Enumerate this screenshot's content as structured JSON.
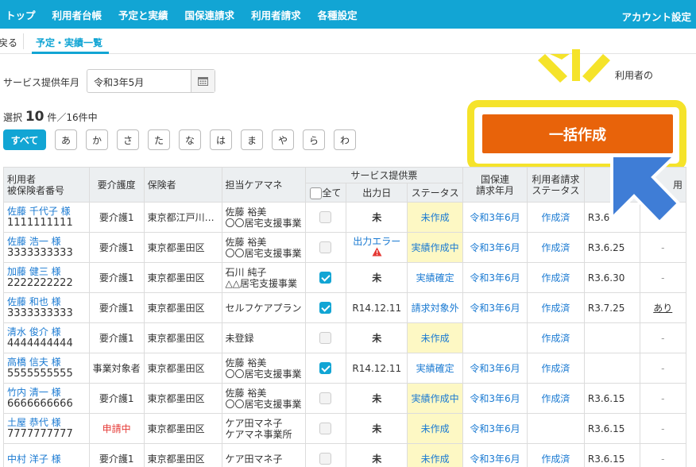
{
  "nav": {
    "items": [
      "トップ",
      "利用者台帳",
      "予定と実績",
      "国保連請求",
      "利用者請求",
      "各種設定"
    ],
    "account": "アカウント設定"
  },
  "sub": {
    "back": "戻る",
    "tab": "予定・実績一覧"
  },
  "month": {
    "label": "サービス提供年月",
    "value": "令和3年5月"
  },
  "notice": "利用者の",
  "selection": {
    "prefix": "選択",
    "count": "10",
    "suffix": "件／16件中"
  },
  "kana": [
    "すべて",
    "あ",
    "か",
    "さ",
    "た",
    "な",
    "は",
    "ま",
    "や",
    "ら",
    "わ"
  ],
  "bulk_button": "一括作成",
  "headers": {
    "user": "利用者",
    "insured_no": "被保険者番号",
    "care": "要介護度",
    "insurer": "保険者",
    "manager": "担当ケアマネ",
    "service": "サービス提供票",
    "all": "全て",
    "out_date": "出力日",
    "status": "ステータス",
    "kokuho1": "国保連",
    "kokuho2": "請求年月",
    "ureq1": "利用者請求",
    "ureq2": "ステータス",
    "c9": "",
    "c10": "",
    "c11": "用"
  },
  "rows": [
    {
      "name": "佐藤 千代子 様",
      "no": "1111111111",
      "care": "要介護1",
      "insurer": "東京都江戸川…",
      "mgr1": "佐藤 裕美",
      "mgr2": "〇〇居宅支援事業",
      "checked": false,
      "out": "未",
      "status": "未作成",
      "status_bg": true,
      "kokuho": "令和3年6月",
      "ureq": "作成済",
      "date": "R3.6",
      "extra": ""
    },
    {
      "name": "佐藤 浩一 様",
      "no": "3333333333",
      "care": "要介護1",
      "insurer": "東京都墨田区",
      "mgr1": "佐藤 裕美",
      "mgr2": "〇〇居宅支援事業",
      "checked": false,
      "out": "出力エラー",
      "status": "実績作成中",
      "status_bg": true,
      "kokuho": "令和3年6月",
      "ureq": "作成済",
      "date": "R3.6.25",
      "extra": "-"
    },
    {
      "name": "加藤 健三 様",
      "no": "2222222222",
      "care": "要介護1",
      "insurer": "東京都墨田区",
      "mgr1": "石川 純子",
      "mgr2": "△△居宅支援事業",
      "checked": true,
      "out": "未",
      "status": "実績確定",
      "status_bg": false,
      "kokuho": "令和3年6月",
      "ureq": "作成済",
      "date": "R3.6.30",
      "extra": "-"
    },
    {
      "name": "佐藤 和也 様",
      "no": "3333333333",
      "care": "要介護1",
      "insurer": "東京都墨田区",
      "mgr1": "セルフケアプラン",
      "mgr2": "",
      "checked": true,
      "out": "R14.12.11",
      "status": "請求対象外",
      "status_bg": false,
      "kokuho": "令和3年6月",
      "ureq": "作成済",
      "date": "R3.7.25",
      "extra": "あり"
    },
    {
      "name": "清水 俊介 様",
      "no": "4444444444",
      "care": "要介護1",
      "insurer": "東京都墨田区",
      "mgr1": "未登録",
      "mgr2": "",
      "checked": false,
      "out": "未",
      "status": "未作成",
      "status_bg": true,
      "kokuho": "",
      "ureq": "作成済",
      "date": "",
      "extra": "-"
    },
    {
      "name": "高橋 信夫 様",
      "no": "5555555555",
      "care": "事業対象者",
      "insurer": "東京都墨田区",
      "mgr1": "佐藤 裕美",
      "mgr2": "〇〇居宅支援事業",
      "checked": true,
      "out": "R14.12.11",
      "status": "実績確定",
      "status_bg": false,
      "kokuho": "令和3年6月",
      "ureq": "作成済",
      "date": "",
      "extra": "-"
    },
    {
      "name": "竹内 清一 様",
      "no": "6666666666",
      "care": "要介護1",
      "insurer": "東京都墨田区",
      "mgr1": "佐藤 裕美",
      "mgr2": "〇〇居宅支援事業",
      "checked": false,
      "out": "未",
      "status": "実績作成中",
      "status_bg": true,
      "kokuho": "令和3年6月",
      "ureq": "作成済",
      "date": "R3.6.15",
      "extra": "-"
    },
    {
      "name": "土屋 恭代 様",
      "no": "7777777777",
      "care": "申請中",
      "insurer": "東京都墨田区",
      "mgr1": "ケア田マネ子",
      "mgr2": "ケアマネ事業所",
      "checked": false,
      "out": "未",
      "status": "未作成",
      "status_bg": true,
      "kokuho": "令和3年6月",
      "ureq": "",
      "date": "R3.6.15",
      "extra": "-"
    },
    {
      "name": "中村 洋子 様",
      "no": "",
      "care": "要介護1",
      "insurer": "東京都墨田区",
      "mgr1": "ケア田マネ子",
      "mgr2": "",
      "checked": false,
      "out": "未",
      "status": "未作成",
      "status_bg": true,
      "kokuho": "令和3年6月",
      "ureq": "作成済",
      "date": "R3.6.15",
      "extra": "-"
    }
  ]
}
